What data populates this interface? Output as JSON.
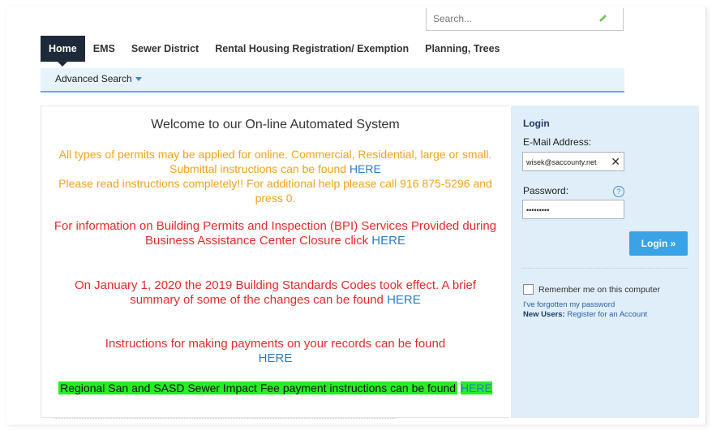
{
  "search": {
    "placeholder": "Search..."
  },
  "nav": {
    "items": [
      {
        "label": "Home"
      },
      {
        "label": "EMS"
      },
      {
        "label": "Sewer District"
      },
      {
        "label": "Rental Housing Registration/ Exemption"
      },
      {
        "label": "Planning, Trees"
      }
    ]
  },
  "subnav": {
    "advanced_search": "Advanced Search"
  },
  "main": {
    "welcome": "Welcome to our On-line Automated System",
    "p1": "All types of permits may be applied for online. Commercial, Residential, large or small. Submittal instructions can be found",
    "p1_link": "HERE",
    "p1b": "Please read instructions completely!! For additional help please call 916 875-5296 and press 0.",
    "p2": "For information on Building Permits and Inspection (BPI) Services Provided during Business Assistance Center Closure click",
    "p2_link": "HERE",
    "p3": "On January 1, 2020 the 2019 Building Standards Codes took effect. A brief summary of some of the changes can be found",
    "p3_link": "HERE",
    "p4": "Instructions for making payments on your records can be found",
    "p4_link": "HERE",
    "p5": "Regional San and SASD Sewer Impact Fee payment instructions can be found",
    "p5_link": "HERE"
  },
  "login": {
    "title": "Login",
    "email_label": "E-Mail Address:",
    "email_value": "wisek@saccounty.net",
    "password_label": "Password:",
    "password_value": "•••••••••",
    "button": "Login »",
    "remember": "Remember me on this computer",
    "forgot": "I've forgotten my password",
    "new_users_label": "New Users:",
    "register": "Register for an Account"
  },
  "colors": {
    "orange": "#f2a21a",
    "red": "#e52a2a",
    "link": "#2b7cc4",
    "highlight": "#27ec27",
    "nav_active": "#1e2a3a",
    "login_button": "#3aa3e6"
  }
}
